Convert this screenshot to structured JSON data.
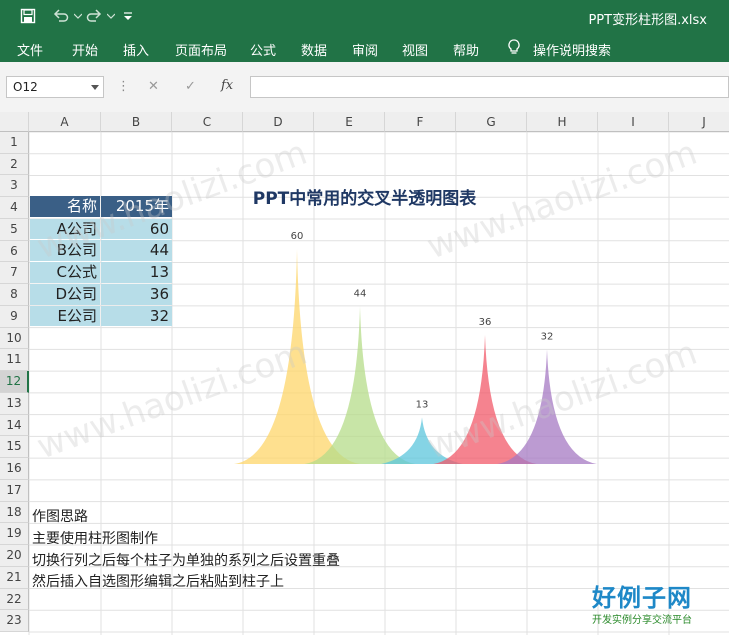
{
  "window": {
    "title": "PPT变形柱形图.xlsx"
  },
  "menu": [
    "文件",
    "开始",
    "插入",
    "页面布局",
    "公式",
    "数据",
    "审阅",
    "视图",
    "帮助",
    "操作说明搜索"
  ],
  "formula_bar": {
    "name_box": "O12",
    "fx_label": "fx",
    "formula": ""
  },
  "columns": [
    "A",
    "B",
    "C",
    "D",
    "E",
    "F",
    "G",
    "H",
    "I",
    "J"
  ],
  "rows": [
    "1",
    "2",
    "3",
    "4",
    "5",
    "6",
    "7",
    "8",
    "9",
    "10",
    "11",
    "12",
    "13",
    "14",
    "15",
    "16",
    "17",
    "18",
    "19",
    "20",
    "21",
    "22",
    "23"
  ],
  "selected_row": "12",
  "table": {
    "header": [
      "名称",
      "2015年"
    ],
    "rows": [
      [
        "A公司",
        "60"
      ],
      [
        "B公司",
        "44"
      ],
      [
        "C公式",
        "13"
      ],
      [
        "D公司",
        "36"
      ],
      [
        "E公司",
        "32"
      ]
    ]
  },
  "chart_data": {
    "type": "area",
    "title": "PPT中常用的交叉半透明图表",
    "categories": [
      "A公司",
      "B公司",
      "C公式",
      "D公司",
      "E公司"
    ],
    "values": [
      60,
      44,
      13,
      36,
      32
    ],
    "colors": [
      "#fdd56a",
      "#b5dc8a",
      "#5cc6dc",
      "#f25a6a",
      "#a57ac3"
    ],
    "ylim": [
      0,
      60
    ]
  },
  "notes": [
    "作图思路",
    "主要使用柱形图制作",
    "切换行列之后每个柱子为单独的系列之后设置重叠",
    "然后插入自选图形编辑之后粘贴到柱子上"
  ],
  "watermark": {
    "brand": "好例子网",
    "sub": "开发实例分享交流平台",
    "site": "www.haolizi.com"
  }
}
